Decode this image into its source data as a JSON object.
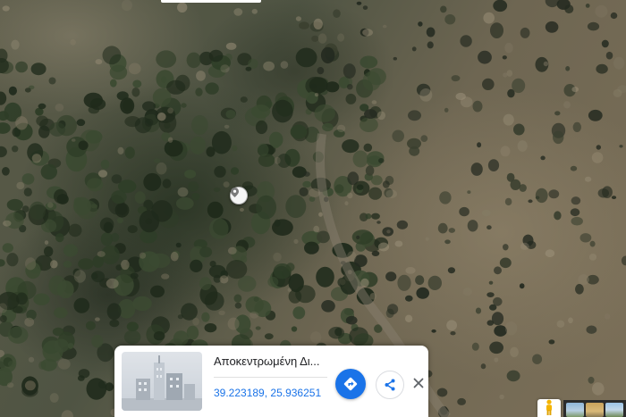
{
  "map": {
    "type": "satellite",
    "marker_icon": "location-pin-icon"
  },
  "info_card": {
    "title": "Αποκεντρωμένη Δι...",
    "coordinates": "39.223189, 25.936251",
    "thumbnail_icon": "building-placeholder-icon",
    "directions_icon": "directions-icon",
    "share_icon": "share-icon",
    "close_icon": "close-icon",
    "accent_color": "#1a73e8"
  },
  "controls": {
    "pegman_icon": "pegman-icon",
    "pegman_color": "#f4b400",
    "photo_thumbnails": [
      "photo-thumbnail",
      "photo-thumbnail",
      "photo-thumbnail"
    ]
  }
}
